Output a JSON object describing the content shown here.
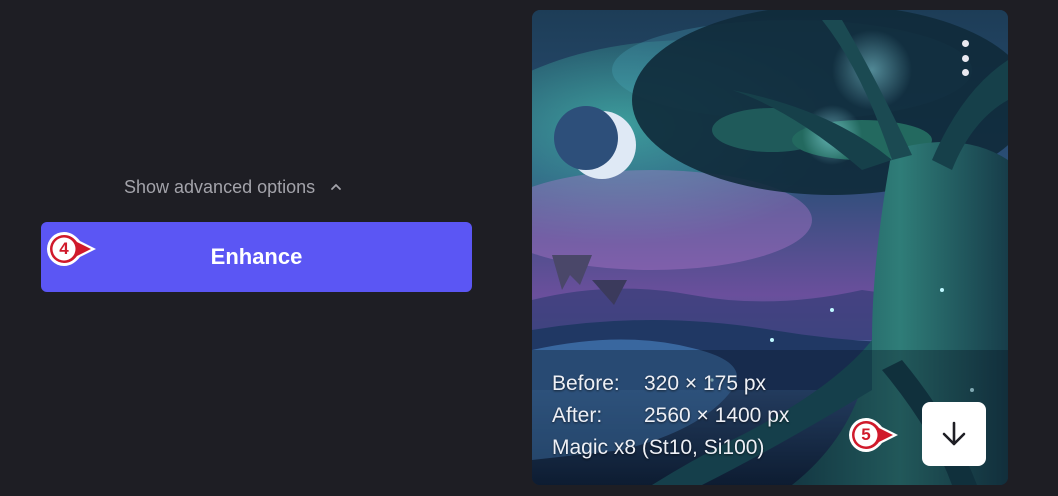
{
  "advanced_toggle": {
    "label": "Show advanced options",
    "icon": "chevron-up-icon"
  },
  "enhance_button": {
    "label": "Enhance"
  },
  "markers": {
    "first": "4",
    "second": "5"
  },
  "result": {
    "before_label": "Before:",
    "before_value": "320 × 175 px",
    "after_label": "After:",
    "after_value": "2560 × 1400 px",
    "model_info": "Magic x8 (St10, Si100)",
    "menu_icon": "more-vertical-icon",
    "download_icon": "download-arrow-icon"
  },
  "colors": {
    "background": "#1e1e24",
    "accent": "#5b56f4",
    "muted_text": "#a3a3aa",
    "marker_red": "#d01a2b"
  }
}
